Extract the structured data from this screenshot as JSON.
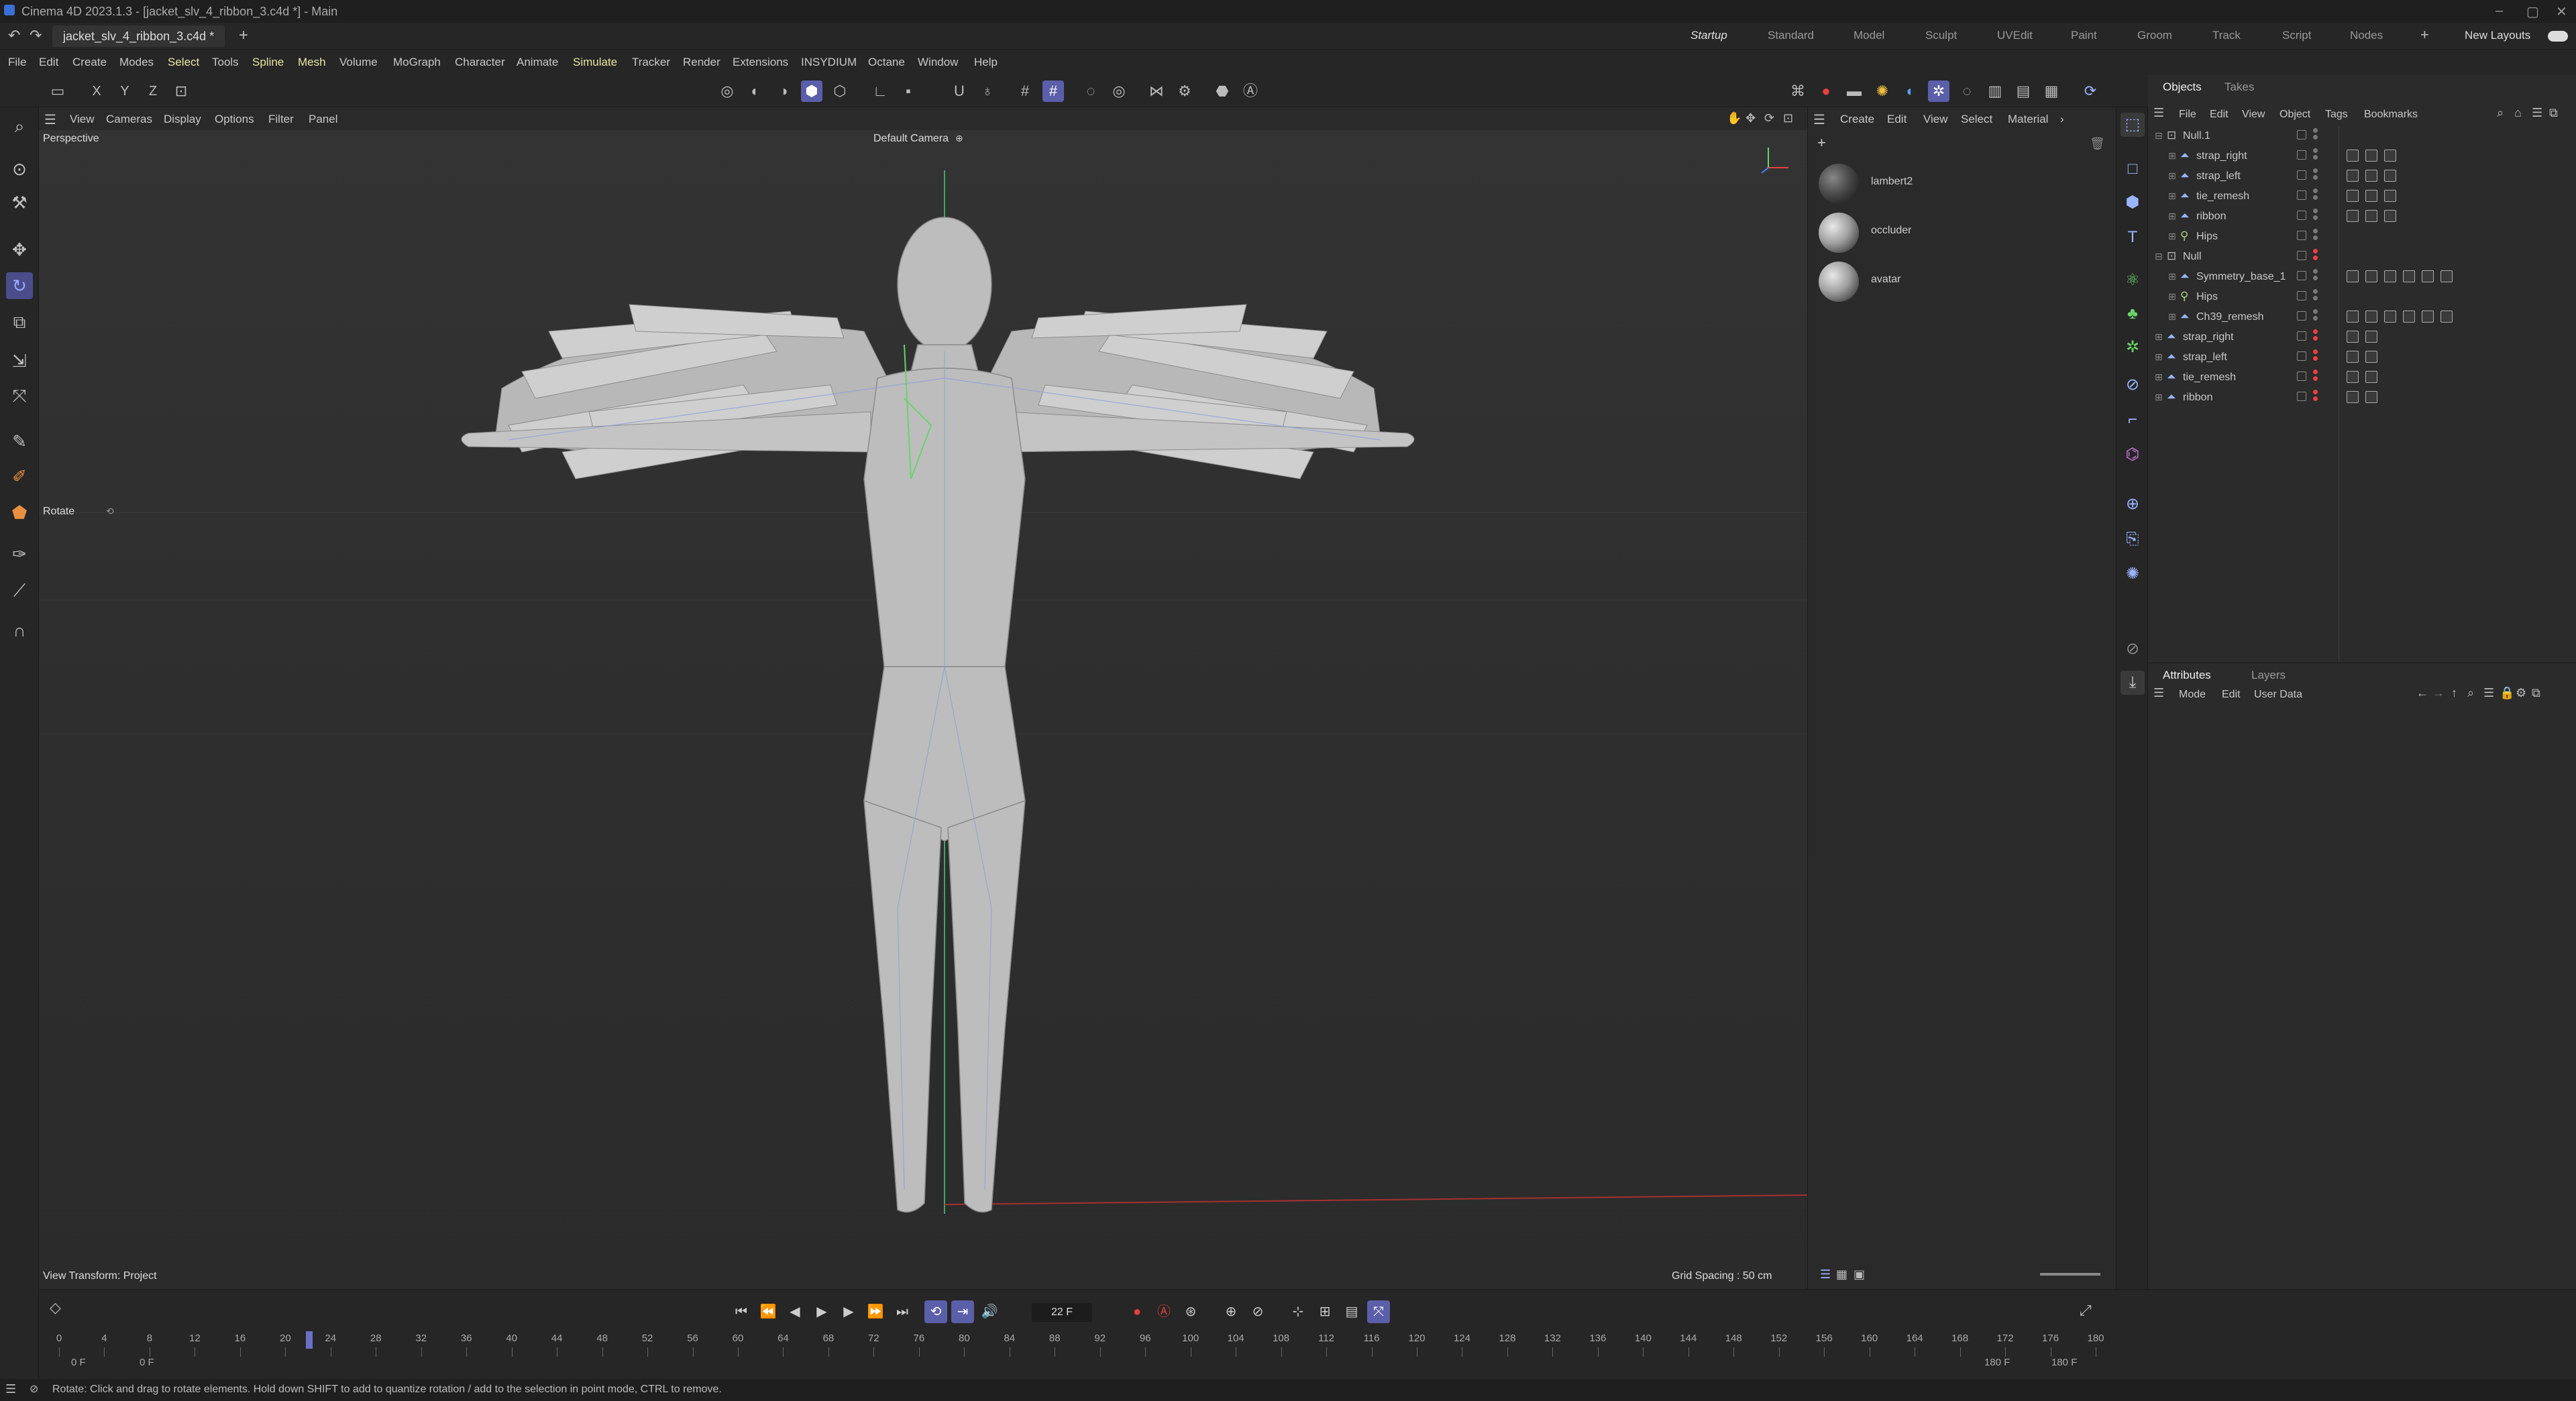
{
  "window": {
    "title": "Cinema 4D 2023.1.3 - [jacket_slv_4_ribbon_3.c4d *] - Main",
    "controls": [
      "–",
      "▢",
      "✕"
    ]
  },
  "tabs": {
    "doc_tab": "jacket_slv_4_ribbon_3.c4d *",
    "add": "+",
    "layouts": [
      "Startup",
      "Standard",
      "Model",
      "Sculpt",
      "UVEdit",
      "Paint",
      "Groom",
      "Track",
      "Script",
      "Nodes"
    ],
    "active_layout": "Startup",
    "new_layouts": "New Layouts"
  },
  "menu": [
    "File",
    "Edit",
    "Create",
    "Modes",
    "Select",
    "Tools",
    "Spline",
    "Mesh",
    "Volume",
    "MoGraph",
    "Character",
    "Animate",
    "Simulate",
    "Tracker",
    "Render",
    "Extensions",
    "INSYDIUM",
    "Octane",
    "Window",
    "Help"
  ],
  "axis_buttons": [
    "X",
    "Y",
    "Z"
  ],
  "viewport": {
    "menu": [
      "View",
      "Cameras",
      "Display",
      "Options",
      "Filter",
      "Panel"
    ],
    "view_name": "Perspective",
    "camera": "Default Camera",
    "tool_label": "Rotate",
    "view_transform": "View Transform: Project",
    "grid_spacing": "Grid Spacing : 50 cm"
  },
  "material_manager": {
    "menu": [
      "Create",
      "Edit",
      "View",
      "Select",
      "Material"
    ],
    "materials": [
      "lambert2",
      "occluder",
      "avatar"
    ]
  },
  "object_manager": {
    "tabs": [
      "Objects",
      "Takes"
    ],
    "menu": [
      "File",
      "Edit",
      "View",
      "Object",
      "Tags",
      "Bookmarks"
    ],
    "objects": [
      {
        "name": "Null.1",
        "depth": 0,
        "icon": "null",
        "expand": "⊟"
      },
      {
        "name": "strap_right",
        "depth": 1,
        "icon": "mesh",
        "expand": "⊞"
      },
      {
        "name": "strap_left",
        "depth": 1,
        "icon": "mesh",
        "expand": "⊞"
      },
      {
        "name": "tie_remesh",
        "depth": 1,
        "icon": "mesh",
        "expand": "⊞"
      },
      {
        "name": "ribbon",
        "depth": 1,
        "icon": "mesh",
        "expand": "⊞"
      },
      {
        "name": "Hips",
        "depth": 1,
        "icon": "joint",
        "expand": "⊞"
      },
      {
        "name": "Null",
        "depth": 0,
        "icon": "null",
        "expand": "⊟"
      },
      {
        "name": "Symmetry_base_1",
        "depth": 1,
        "icon": "mesh",
        "expand": "⊞"
      },
      {
        "name": "Hips",
        "depth": 1,
        "icon": "joint",
        "expand": "⊞"
      },
      {
        "name": "Ch39_remesh",
        "depth": 1,
        "icon": "mesh",
        "expand": "⊞"
      },
      {
        "name": "strap_right",
        "depth": 0,
        "icon": "mesh",
        "expand": "⊞"
      },
      {
        "name": "strap_left",
        "depth": 0,
        "icon": "mesh",
        "expand": "⊞"
      },
      {
        "name": "tie_remesh",
        "depth": 0,
        "icon": "mesh",
        "expand": "⊞"
      },
      {
        "name": "ribbon",
        "depth": 0,
        "icon": "mesh",
        "expand": "⊞"
      }
    ]
  },
  "attributes": {
    "tabs": [
      "Attributes",
      "Layers"
    ],
    "menu": [
      "Mode",
      "Edit",
      "User Data"
    ]
  },
  "timeline": {
    "current_frame": "22 F",
    "ticks": [
      0,
      4,
      8,
      12,
      16,
      20,
      24,
      28,
      32,
      36,
      40,
      44,
      48,
      52,
      56,
      60,
      64,
      68,
      72,
      76,
      80,
      84,
      88,
      92,
      96,
      100,
      104,
      108,
      112,
      116,
      120,
      124,
      128,
      132,
      136,
      140,
      144,
      148,
      152,
      156,
      160,
      164,
      168,
      172,
      176,
      180
    ],
    "start_a": "0 F",
    "start_b": "0 F",
    "end_a": "180 F",
    "end_b": "180 F"
  },
  "status": {
    "message": "Rotate: Click and drag to rotate elements. Hold down SHIFT to add to quantize rotation / add to the selection in point mode, CTRL to remove."
  },
  "colors": {
    "accent": "#5b5ea8",
    "highlight_menu": "#e8e6a0",
    "record_red": "#e84040",
    "icon_blue": "#9ab4ff"
  }
}
